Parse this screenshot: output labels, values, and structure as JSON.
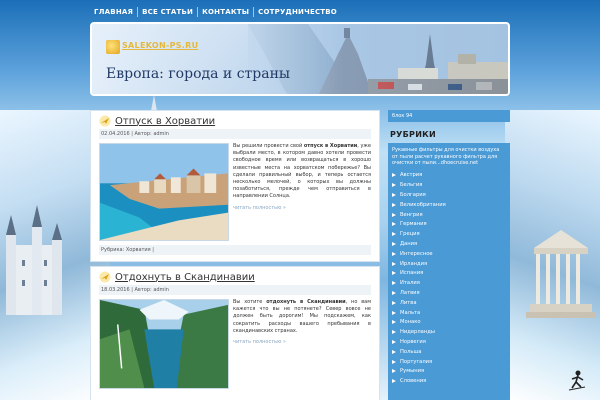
{
  "nav": {
    "items": [
      {
        "label": "ГЛАВНАЯ"
      },
      {
        "label": "ВСЕ СТАТЬИ"
      },
      {
        "label": "КОНТАКТЫ"
      },
      {
        "label": "СОТРУДНИЧЕСТВО"
      }
    ]
  },
  "header": {
    "logo_url": "SALEKON-PS.RU",
    "title": "Европа: города и страны"
  },
  "posts": [
    {
      "title": "Отпуск в Хорватии",
      "date": "02.04.2016",
      "author_label": "Автор:",
      "author": "admin",
      "excerpt_pre": "Вы решили провести свой ",
      "excerpt_bold": "отпуск в Хорватии",
      "excerpt_post": ", уже выбрали место, в котором давно хотели провести свободное время или возвращаться в хорошо известные места на хорватском побережье? Вы сделали правильный выбор, и теперь остается несколько мелочей, о которых вы должны позаботиться, прежде чем отправиться в направлении Солнца.",
      "more": "читать полностью »",
      "rubric_label": "Рубрика:",
      "rubric": "Хорватия"
    },
    {
      "title": "Отдохнуть в Скандинавии",
      "date": "18.03.2016",
      "author_label": "Автор:",
      "author": "admin",
      "excerpt_pre": "Вы хотите ",
      "excerpt_bold": "отдохнуть в Скандинавии",
      "excerpt_post": ", но вам кажется что вы не потянете? Север вовсе не должен быть дорогим! Мы подскажем, как сократить расходы вашего пребывания в скандинавских странах.",
      "more": "читать полностью »"
    }
  ],
  "sidebar": {
    "block_label": "блок 94",
    "rubriki_title": "РУБРИКИ",
    "rubriki_desc": "Рукавные фильтры для очистки воздуха от пыли расчет рукавного фильтра для очистки от пыли...dhoecruise.net",
    "categories": [
      "Австрия",
      "Бельгия",
      "Болгария",
      "Великобритания",
      "Венгрия",
      "Германия",
      "Греция",
      "Дания",
      "Интересное",
      "Ирландия",
      "Испания",
      "Италия",
      "Латвия",
      "Литва",
      "Мальта",
      "Монако",
      "Нидерланды",
      "Норвегия",
      "Польша",
      "Португалия",
      "Румыния",
      "Словения"
    ]
  }
}
